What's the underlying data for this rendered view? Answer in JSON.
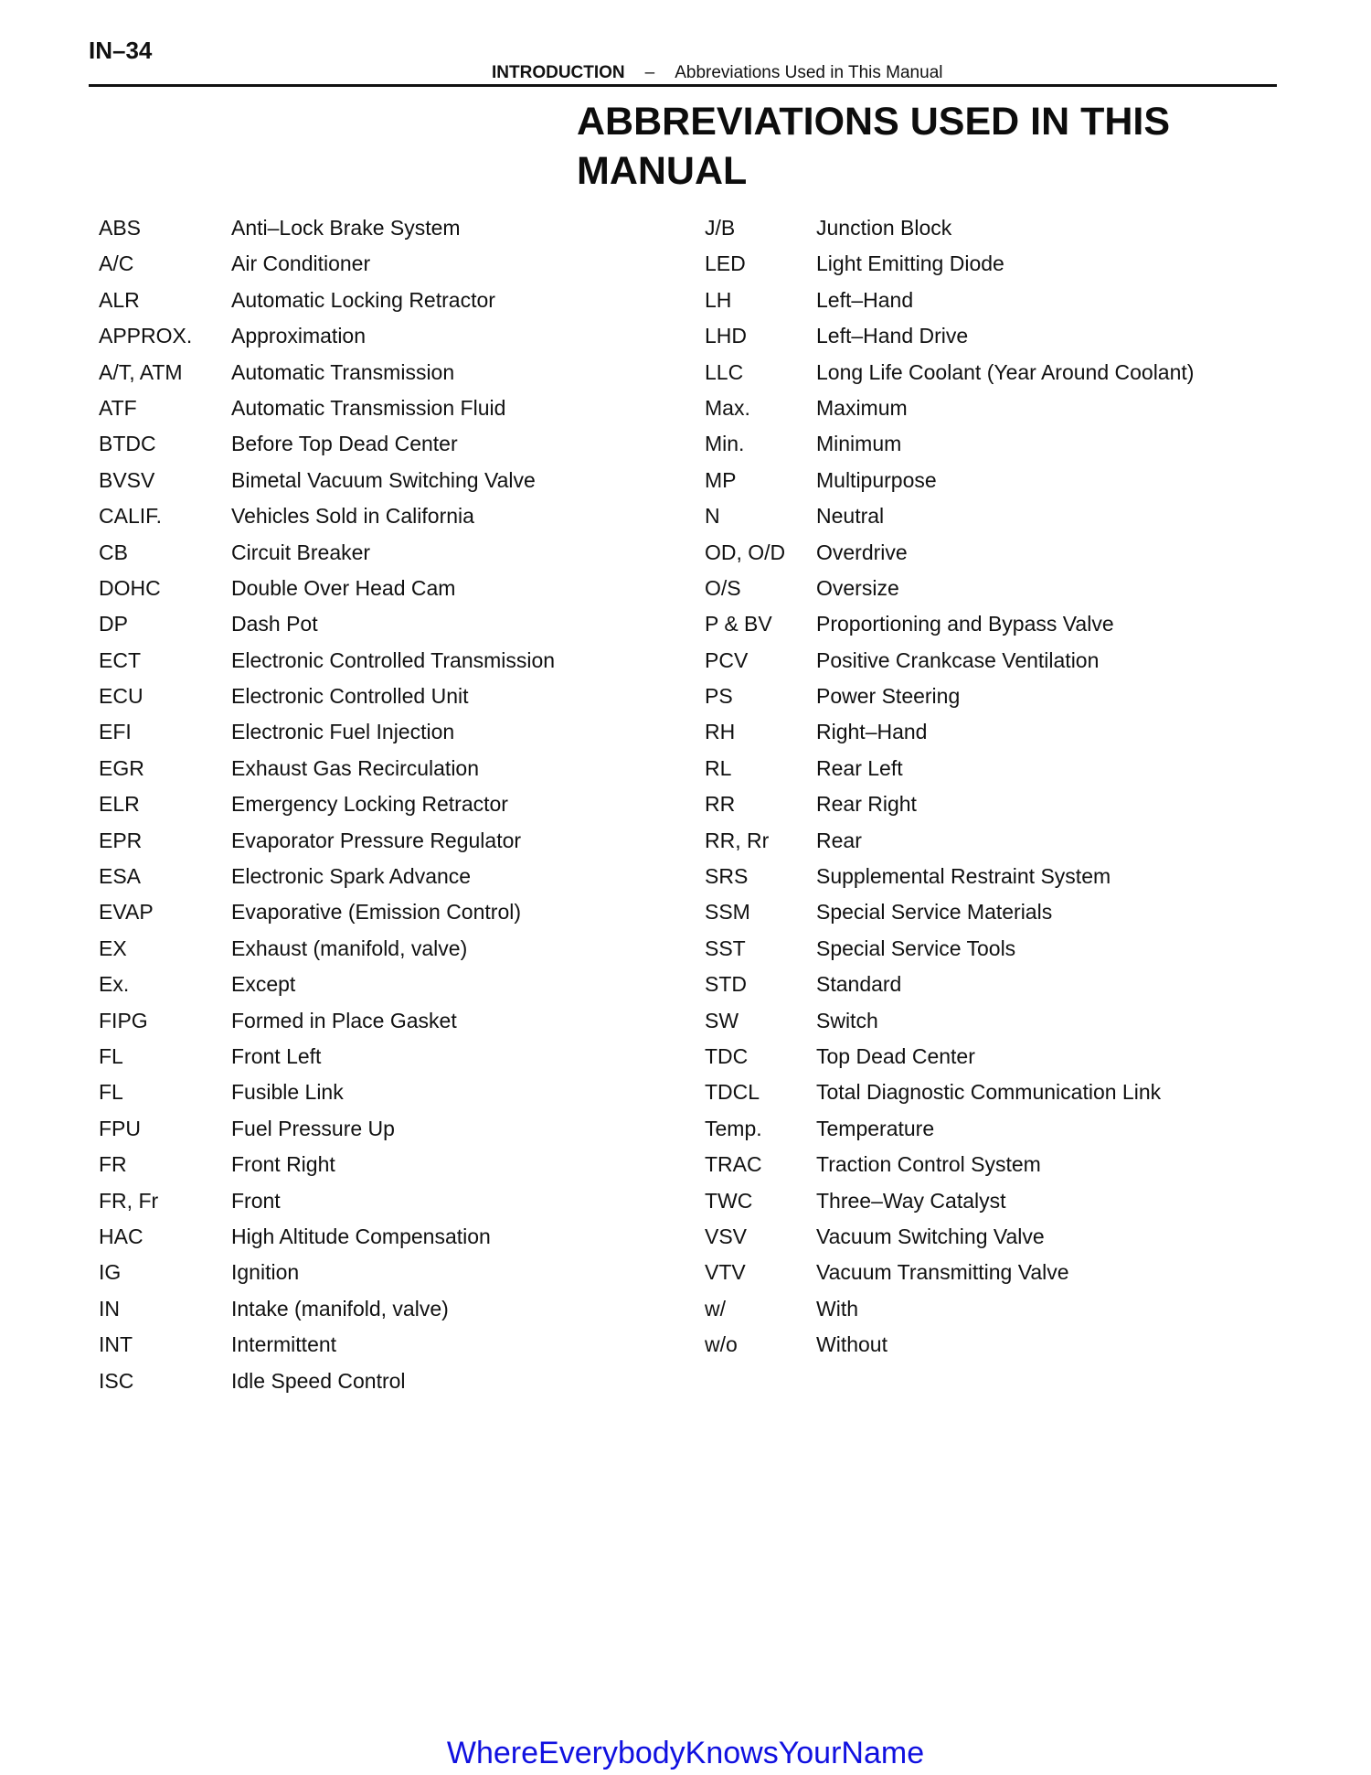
{
  "header": {
    "page_number": "IN–34",
    "section": "INTRODUCTION",
    "separator": "–",
    "subsection": "Abbreviations Used in This Manual"
  },
  "title": {
    "line1": "ABBREVIATIONS USED IN THIS",
    "line2": "MANUAL"
  },
  "left_column": [
    {
      "abbr": "ABS",
      "meaning": "Anti–Lock Brake System"
    },
    {
      "abbr": "A/C",
      "meaning": "Air Conditioner"
    },
    {
      "abbr": "ALR",
      "meaning": "Automatic Locking Retractor"
    },
    {
      "abbr": "APPROX.",
      "meaning": "Approximation"
    },
    {
      "abbr": "A/T, ATM",
      "meaning": "Automatic Transmission"
    },
    {
      "abbr": "ATF",
      "meaning": "Automatic Transmission Fluid"
    },
    {
      "abbr": "BTDC",
      "meaning": "Before Top Dead Center"
    },
    {
      "abbr": "BVSV",
      "meaning": "Bimetal Vacuum Switching Valve"
    },
    {
      "abbr": "CALIF.",
      "meaning": "Vehicles Sold in California"
    },
    {
      "abbr": "CB",
      "meaning": "Circuit Breaker"
    },
    {
      "abbr": "DOHC",
      "meaning": "Double Over Head Cam"
    },
    {
      "abbr": "DP",
      "meaning": "Dash Pot"
    },
    {
      "abbr": "ECT",
      "meaning": "Electronic Controlled Transmission"
    },
    {
      "abbr": "ECU",
      "meaning": "Electronic Controlled Unit"
    },
    {
      "abbr": "EFI",
      "meaning": "Electronic Fuel Injection"
    },
    {
      "abbr": "EGR",
      "meaning": "Exhaust Gas Recirculation"
    },
    {
      "abbr": "ELR",
      "meaning": "Emergency Locking Retractor"
    },
    {
      "abbr": "EPR",
      "meaning": "Evaporator Pressure Regulator"
    },
    {
      "abbr": "ESA",
      "meaning": "Electronic Spark Advance"
    },
    {
      "abbr": "EVAP",
      "meaning": "Evaporative (Emission Control)"
    },
    {
      "abbr": "EX",
      "meaning": "Exhaust (manifold, valve)"
    },
    {
      "abbr": "Ex.",
      "meaning": "Except"
    },
    {
      "abbr": "FIPG",
      "meaning": "Formed in Place Gasket"
    },
    {
      "abbr": "FL",
      "meaning": "Front Left"
    },
    {
      "abbr": "FL",
      "meaning": "Fusible Link"
    },
    {
      "abbr": "FPU",
      "meaning": "Fuel Pressure Up"
    },
    {
      "abbr": "FR",
      "meaning": "Front Right"
    },
    {
      "abbr": "FR, Fr",
      "meaning": "Front"
    },
    {
      "abbr": "HAC",
      "meaning": "High Altitude Compensation"
    },
    {
      "abbr": "IG",
      "meaning": "Ignition"
    },
    {
      "abbr": "IN",
      "meaning": "Intake (manifold, valve)"
    },
    {
      "abbr": "INT",
      "meaning": "Intermittent"
    },
    {
      "abbr": "ISC",
      "meaning": "Idle Speed Control"
    }
  ],
  "right_column": [
    {
      "abbr": "J/B",
      "meaning": "Junction Block"
    },
    {
      "abbr": "LED",
      "meaning": "Light Emitting Diode"
    },
    {
      "abbr": "LH",
      "meaning": "Left–Hand"
    },
    {
      "abbr": "LHD",
      "meaning": "Left–Hand Drive"
    },
    {
      "abbr": "LLC",
      "meaning": "Long Life Coolant (Year Around Coolant)"
    },
    {
      "abbr": "Max.",
      "meaning": "Maximum"
    },
    {
      "abbr": "Min.",
      "meaning": "Minimum"
    },
    {
      "abbr": "MP",
      "meaning": "Multipurpose"
    },
    {
      "abbr": "N",
      "meaning": "Neutral"
    },
    {
      "abbr": "OD, O/D",
      "meaning": "Overdrive"
    },
    {
      "abbr": "O/S",
      "meaning": "Oversize"
    },
    {
      "abbr": "P & BV",
      "meaning": "Proportioning and Bypass Valve"
    },
    {
      "abbr": "PCV",
      "meaning": "Positive Crankcase Ventilation"
    },
    {
      "abbr": "PS",
      "meaning": "Power Steering"
    },
    {
      "abbr": "RH",
      "meaning": "Right–Hand"
    },
    {
      "abbr": "RL",
      "meaning": "Rear Left"
    },
    {
      "abbr": "RR",
      "meaning": "Rear Right"
    },
    {
      "abbr": "RR, Rr",
      "meaning": "Rear"
    },
    {
      "abbr": "SRS",
      "meaning": "Supplemental Restraint System"
    },
    {
      "abbr": "SSM",
      "meaning": "Special Service Materials"
    },
    {
      "abbr": "SST",
      "meaning": "Special Service Tools"
    },
    {
      "abbr": "STD",
      "meaning": "Standard"
    },
    {
      "abbr": "SW",
      "meaning": "Switch"
    },
    {
      "abbr": "TDC",
      "meaning": "Top Dead Center"
    },
    {
      "abbr": "TDCL",
      "meaning": "Total Diagnostic Communication Link"
    },
    {
      "abbr": "Temp.",
      "meaning": "Temperature"
    },
    {
      "abbr": "TRAC",
      "meaning": "Traction Control System"
    },
    {
      "abbr": "TWC",
      "meaning": "Three–Way Catalyst"
    },
    {
      "abbr": "VSV",
      "meaning": "Vacuum Switching Valve"
    },
    {
      "abbr": "VTV",
      "meaning": "Vacuum Transmitting Valve"
    },
    {
      "abbr": "w/",
      "meaning": "With"
    },
    {
      "abbr": "w/o",
      "meaning": "Without"
    }
  ],
  "footer": {
    "watermark": "WhereEverybodyKnowsYourName",
    "color": "#1010e0"
  }
}
